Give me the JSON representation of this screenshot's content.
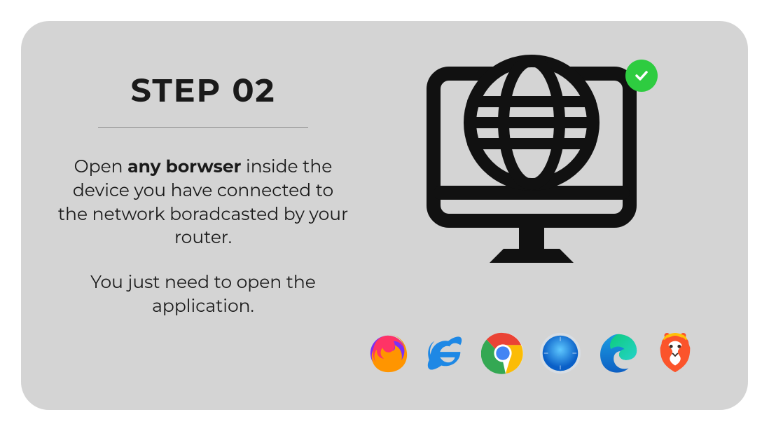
{
  "step": {
    "title": "STEP 02",
    "para1_prefix": "Open ",
    "para1_bold": "any borwser",
    "para1_suffix": " inside the device you have connected to the network boradcasted by your router.",
    "para2": "You just need to open the application."
  },
  "browsers": [
    "firefox",
    "internet-explorer",
    "chrome",
    "safari",
    "edge",
    "brave"
  ],
  "colors": {
    "check": "#2ecc40"
  }
}
